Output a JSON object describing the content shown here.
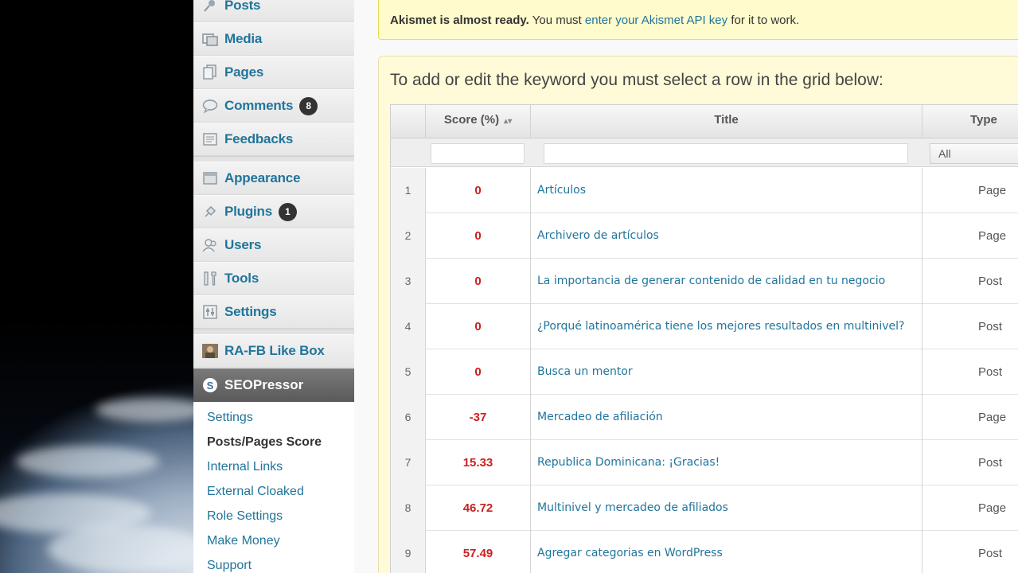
{
  "sidebar": {
    "items": [
      {
        "label": "Posts",
        "icon": "pushpin-icon"
      },
      {
        "label": "Media",
        "icon": "media-icon"
      },
      {
        "label": "Pages",
        "icon": "pages-icon"
      },
      {
        "label": "Comments",
        "icon": "comment-bubble-icon",
        "badge": "8"
      },
      {
        "label": "Feedbacks",
        "icon": "feedback-icon"
      },
      {
        "label": "Appearance",
        "icon": "appearance-icon"
      },
      {
        "label": "Plugins",
        "icon": "plug-icon",
        "badge": "1"
      },
      {
        "label": "Users",
        "icon": "users-icon"
      },
      {
        "label": "Tools",
        "icon": "tools-icon"
      },
      {
        "label": "Settings",
        "icon": "settings-icon"
      },
      {
        "label": "RA-FB Like Box",
        "icon": "avatar-icon"
      }
    ],
    "active": {
      "label": "SEOPressor",
      "icon": "seopressor-logo-icon"
    },
    "submenu": [
      {
        "label": "Settings"
      },
      {
        "label": "Posts/Pages Score"
      },
      {
        "label": "Internal Links"
      },
      {
        "label": "External Cloaked"
      },
      {
        "label": "Role Settings"
      },
      {
        "label": "Make Money"
      },
      {
        "label": "Support"
      }
    ]
  },
  "notice": {
    "bold": "Akismet is almost ready.",
    "text1": "You must",
    "link": "enter your Akismet API key",
    "text2": "for it to work."
  },
  "panel": {
    "heading": "To add or edit the keyword you must select a row in the grid below:"
  },
  "grid": {
    "columns": {
      "score": "Score (%)",
      "title": "Title",
      "type": "Type"
    },
    "type_filter": "All",
    "rows": [
      {
        "num": "1",
        "score": "0",
        "title": "Artículos",
        "type": "Page"
      },
      {
        "num": "2",
        "score": "0",
        "title": "Archivero de artículos",
        "type": "Page"
      },
      {
        "num": "3",
        "score": "0",
        "title": "La importancia de generar contenido de calidad en tu negocio",
        "type": "Post"
      },
      {
        "num": "4",
        "score": "0",
        "title": "¿Porqué latinoamérica tiene los mejores resultados en multinivel?",
        "type": "Post"
      },
      {
        "num": "5",
        "score": "0",
        "title": "Busca un mentor",
        "type": "Post"
      },
      {
        "num": "6",
        "score": "-37",
        "title": "Mercadeo de afiliación",
        "type": "Page"
      },
      {
        "num": "7",
        "score": "15.33",
        "title": "Republica Dominicana: ¡Gracias!",
        "type": "Post"
      },
      {
        "num": "8",
        "score": "46.72",
        "title": "Multinivel y mercadeo de afiliados",
        "type": "Page"
      },
      {
        "num": "9",
        "score": "57.49",
        "title": "Agregar categorias en WordPress",
        "type": "Post"
      }
    ]
  },
  "colors": {
    "link": "#21759b",
    "score": "#cc1f1f",
    "notice_bg": "#fffbcc"
  }
}
